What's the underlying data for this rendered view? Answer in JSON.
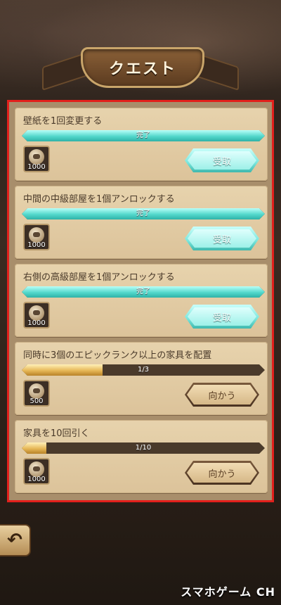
{
  "header": {
    "title": "クエスト"
  },
  "quests": [
    {
      "title": "壁紙を1回変更する",
      "progress_text": "完了",
      "progress": 1.0,
      "status": "done",
      "reward": "1000",
      "button": "受取"
    },
    {
      "title": "中間の中級部屋を1個アンロックする",
      "progress_text": "完了",
      "progress": 1.0,
      "status": "done",
      "reward": "1000",
      "button": "受取"
    },
    {
      "title": "右側の高級部屋を1個アンロックする",
      "progress_text": "完了",
      "progress": 1.0,
      "status": "done",
      "reward": "1000",
      "button": "受取"
    },
    {
      "title": "同時に3個のエピックランク以上の家具を配置",
      "progress_text": "1/3",
      "progress": 0.333,
      "status": "in_progress",
      "reward": "500",
      "button": "向かう"
    },
    {
      "title": "家具を10回引く",
      "progress_text": "1/10",
      "progress": 0.1,
      "status": "in_progress",
      "reward": "1000",
      "button": "向かう"
    }
  ],
  "footer": {
    "back_icon": "back-arrow-icon",
    "watermark": "スマホゲーム CH"
  },
  "colors": {
    "done_bar": "#53d8cc",
    "progress_bar": "#e6b756",
    "highlight_border": "#e2201c"
  }
}
